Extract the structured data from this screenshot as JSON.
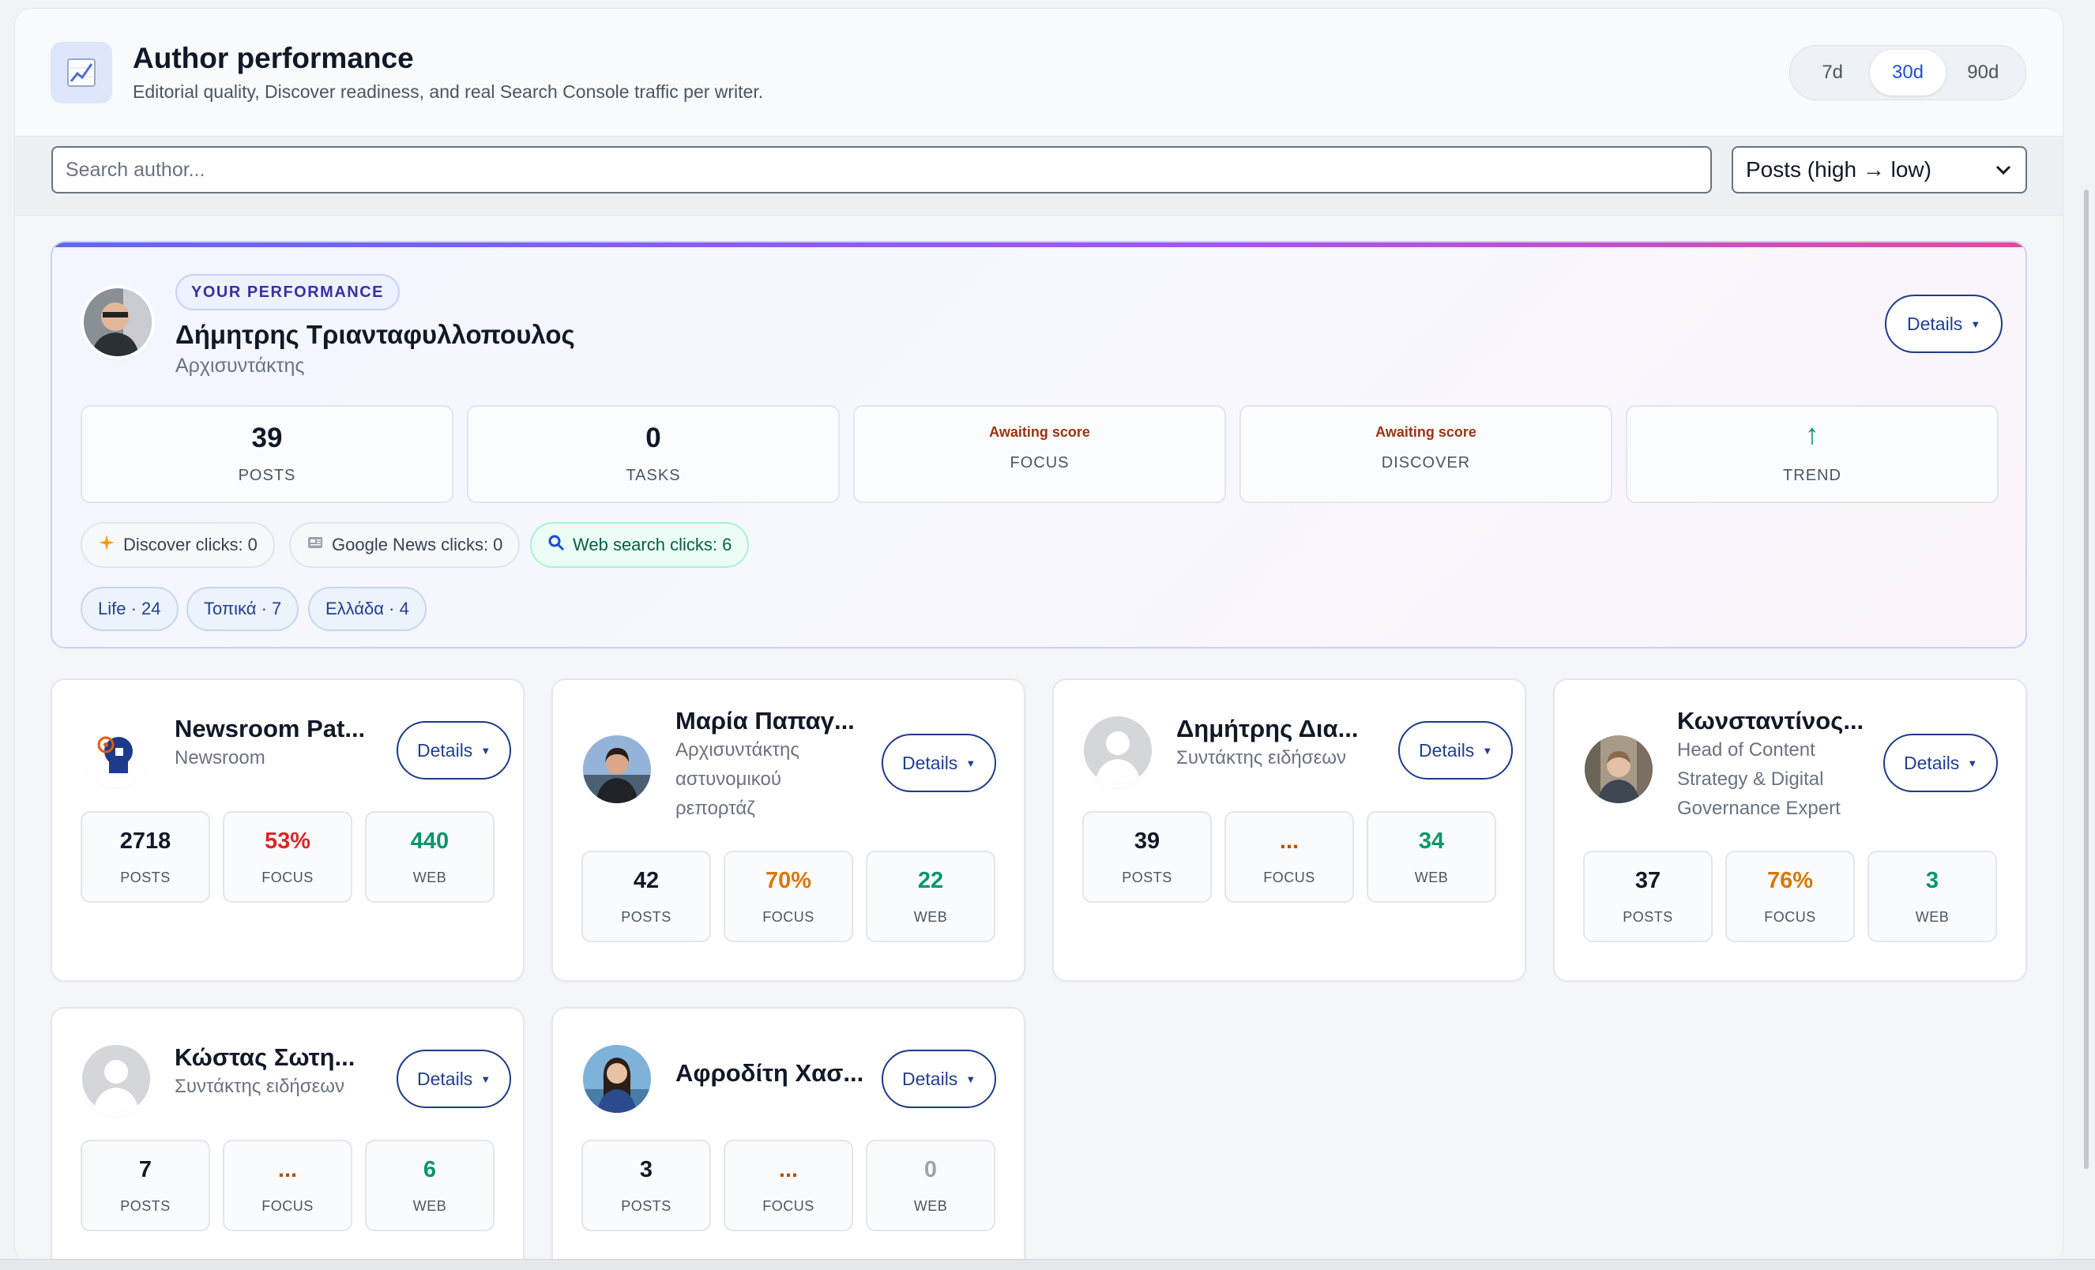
{
  "header": {
    "title": "Author performance",
    "subtitle": "Editorial quality, Discover readiness, and real Search Console traffic per writer.",
    "icon": "chart-line-icon",
    "ranges": [
      "7d",
      "30d",
      "90d"
    ],
    "active_range": "30d"
  },
  "toolbar": {
    "search_placeholder": "Search author...",
    "sort_value": "Posts (high → low)"
  },
  "you": {
    "badge": "YOUR PERFORMANCE",
    "name": "Δήμητρης Τριανταφυλλοπουλος",
    "role": "Αρχισυντάκτης",
    "details": "Details",
    "stats": {
      "posts": {
        "value": "39",
        "label": "POSTS"
      },
      "tasks": {
        "value": "0",
        "label": "TASKS"
      },
      "focus": {
        "status": "Awaiting score",
        "label": "FOCUS"
      },
      "discover": {
        "status": "Awaiting score",
        "label": "DISCOVER"
      },
      "trend": {
        "value": "↑",
        "label": "TREND"
      }
    },
    "clicks": {
      "discover": "Discover clicks: 0",
      "google_news": "Google News clicks: 0",
      "web_search": "Web search clicks: 6"
    },
    "tags": [
      "Life · 24",
      "Τοπικά · 7",
      "Ελλάδα · 4"
    ]
  },
  "authors": [
    {
      "name": "Newsroom Pat...",
      "role": "Newsroom",
      "details": "Details",
      "posts": "2718",
      "focus": "53%",
      "web": "440"
    },
    {
      "name": "Μαρία Παπαγ...",
      "role": "Αρχισυντάκτης αστυνομικού ρεπορτάζ",
      "details": "Details",
      "posts": "42",
      "focus": "70%",
      "web": "22"
    },
    {
      "name": "Δημήτρης Δια...",
      "role": "Συντάκτης ειδήσεων",
      "details": "Details",
      "posts": "39",
      "focus": "...",
      "web": "34"
    },
    {
      "name": "Κωνσταντίνος...",
      "role": "Head of Content Strategy & Digital Governance Expert",
      "details": "Details",
      "posts": "37",
      "focus": "76%",
      "web": "3"
    },
    {
      "name": "Κώστας Σωτη...",
      "role": "Συντάκτης ειδήσεων",
      "details": "Details",
      "posts": "7",
      "focus": "...",
      "web": "6"
    },
    {
      "name": "Αφροδίτη Χασ...",
      "role": "",
      "details": "Details",
      "posts": "3",
      "focus": "...",
      "web": "0"
    }
  ],
  "labels": {
    "posts": "POSTS",
    "focus": "FOCUS",
    "web": "WEB"
  },
  "colors": {
    "accent": "#1d4ed8",
    "positive": "#059669",
    "negative": "#dc2626",
    "warning": "#d97706"
  }
}
